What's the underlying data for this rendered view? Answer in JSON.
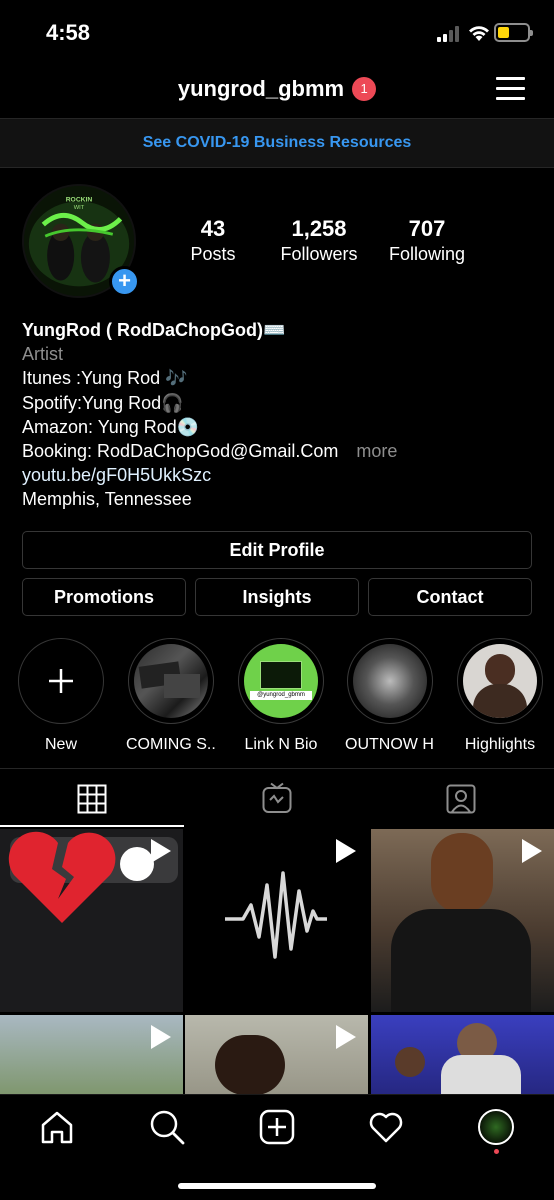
{
  "status_bar": {
    "time": "4:58"
  },
  "header": {
    "username": "yungrod_gbmm",
    "notification_count": "1"
  },
  "banner": {
    "text": "See COVID-19 Business Resources"
  },
  "profile": {
    "stats": [
      {
        "value": "43",
        "label": "Posts"
      },
      {
        "value": "1,258",
        "label": "Followers"
      },
      {
        "value": "707",
        "label": "Following"
      }
    ],
    "avatar_text": "ROCKIN WIT Slime"
  },
  "bio": {
    "name": "YungRod ( RodDaChopGod)⌨️",
    "category": "Artist",
    "lines": [
      "Itunes :Yung Rod 🎶",
      "Spotify:Yung Rod🎧",
      "Amazon: Yung Rod💿",
      "Booking: RodDaChopGod@Gmail.Com"
    ],
    "more": "more",
    "link": "youtu.be/gF0H5UkkSzc",
    "location": "Memphis, Tennessee"
  },
  "buttons": {
    "edit_profile": "Edit Profile",
    "promotions": "Promotions",
    "insights": "Insights",
    "contact": "Contact"
  },
  "highlights": [
    {
      "label": "New"
    },
    {
      "label": "COMING S..."
    },
    {
      "label": "Link N Bio"
    },
    {
      "label": "OUTNOW H..."
    },
    {
      "label": "Highlights"
    }
  ],
  "highlight_overlay_text": "@yungrod_gbmm",
  "tabs": [
    "grid-icon",
    "igtv-icon",
    "tagged-icon"
  ],
  "nav": [
    "home-icon",
    "search-icon",
    "create-icon",
    "activity-icon",
    "profile-icon"
  ],
  "colors": {
    "accent": "#3897f0",
    "badge": "#ed4956",
    "battery": "#ffd60a"
  }
}
